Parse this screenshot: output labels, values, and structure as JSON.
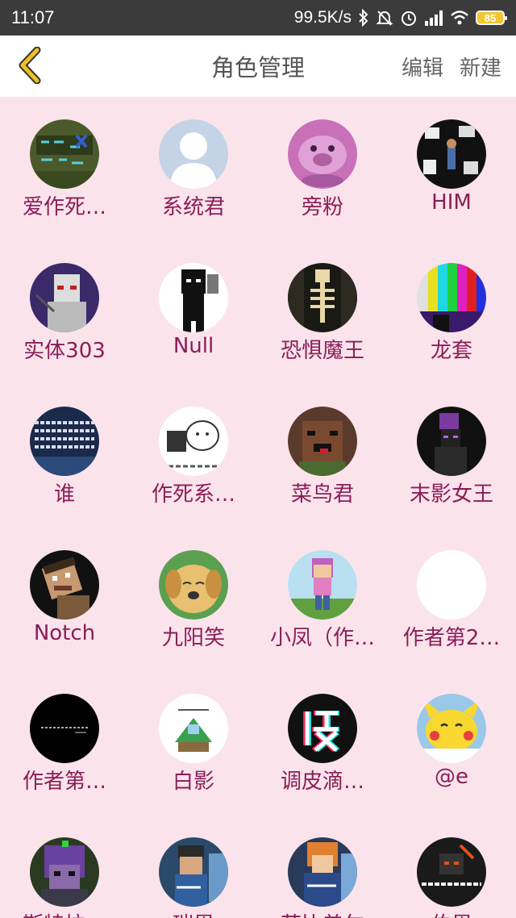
{
  "status_bar": {
    "time": "11:07",
    "net_speed": "99.5K/s",
    "battery": "85",
    "icons": [
      "bluetooth-icon",
      "bell-off-icon",
      "alarm-icon",
      "signal-icon",
      "wifi-icon"
    ]
  },
  "header": {
    "title": "角色管理",
    "edit_label": "编辑",
    "new_label": "新建",
    "back_icon": "chevron-left-icon",
    "accent": "#f0c020"
  },
  "colors": {
    "background": "#fbe3ec",
    "name_text": "#8a1e57"
  },
  "characters": [
    {
      "name": "爱作死…",
      "avatar": "pixel-text-avatar"
    },
    {
      "name": "系统君",
      "avatar": "default-person-avatar"
    },
    {
      "name": "旁粉",
      "avatar": "pink-pig-avatar"
    },
    {
      "name": "HIM",
      "avatar": "comic-collage-avatar"
    },
    {
      "name": "实体303",
      "avatar": "entity303-avatar"
    },
    {
      "name": "Null",
      "avatar": "null-black-figure-avatar"
    },
    {
      "name": "恐惧魔王",
      "avatar": "skeleton-avatar"
    },
    {
      "name": "龙套",
      "avatar": "color-bars-avatar"
    },
    {
      "name": "谁",
      "avatar": "text-image-avatar"
    },
    {
      "name": "作死系…",
      "avatar": "sticker-avatar"
    },
    {
      "name": "菜鸟君",
      "avatar": "derp-face-avatar"
    },
    {
      "name": "末影女王",
      "avatar": "ender-queen-avatar"
    },
    {
      "name": "Notch",
      "avatar": "notch-avatar"
    },
    {
      "name": "九阳笑",
      "avatar": "puppy-avatar"
    },
    {
      "name": "小凤（作…",
      "avatar": "girl-pixel-avatar"
    },
    {
      "name": "作者第2…",
      "avatar": "blank-white-avatar"
    },
    {
      "name": "作者第…",
      "avatar": "black-text-avatar"
    },
    {
      "name": "白影",
      "avatar": "island-avatar"
    },
    {
      "name": "调皮滴…",
      "avatar": "glitch-char-avatar"
    },
    {
      "name": "@e",
      "avatar": "pikachu-avatar"
    },
    {
      "name": "斯特拉…",
      "avatar": "purple-hair-avatar"
    },
    {
      "name": "瑞恩",
      "avatar": "boy-pixel-avatar"
    },
    {
      "name": "芙比盖尔",
      "avatar": "orange-hair-avatar"
    },
    {
      "name": "伯恩",
      "avatar": "blackbone-avatar"
    }
  ]
}
